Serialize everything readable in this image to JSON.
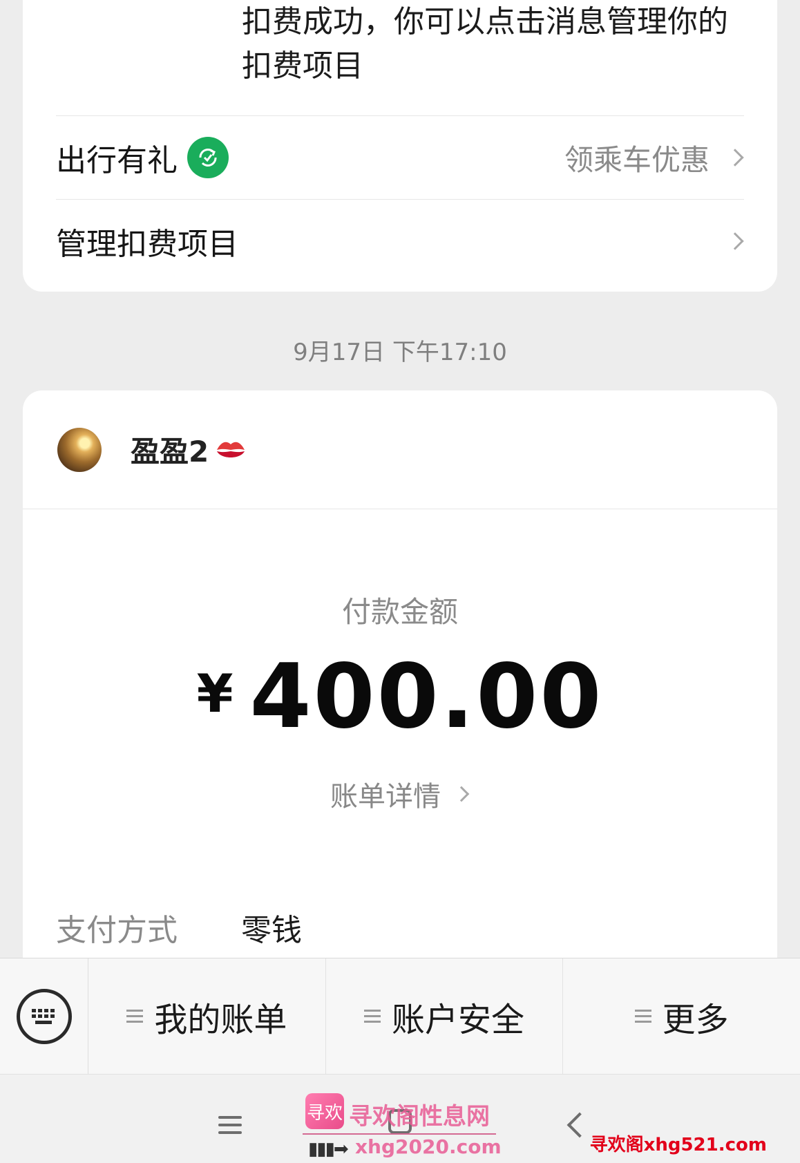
{
  "notice": {
    "text_line1": "扣费成功，你可以点击消息管理你的",
    "text_line2": "扣费项目"
  },
  "rows": {
    "travel": {
      "label": "出行有礼",
      "value": "领乘车优惠"
    },
    "manage": {
      "label": "管理扣费项目"
    }
  },
  "timestamp": "9月17日 下午17:10",
  "payment": {
    "payee_name": "盈盈2",
    "amount_label": "付款金额",
    "currency": "¥",
    "amount": "400.00",
    "bill_detail": "账单详情",
    "method_key": "支付方式",
    "method_value": "零钱"
  },
  "bottom_menu": {
    "items": [
      {
        "label": "我的账单"
      },
      {
        "label": "账户安全"
      },
      {
        "label": "更多"
      }
    ]
  },
  "watermark": {
    "logo": "寻欢",
    "title": "寻欢阁性息网",
    "url": "xhg2020.com",
    "url_right": "寻欢阁xhg521.com"
  },
  "colors": {
    "badge_green": "#1aad5b",
    "watermark_pink": "#e75c94",
    "watermark_red": "#e2001a"
  }
}
